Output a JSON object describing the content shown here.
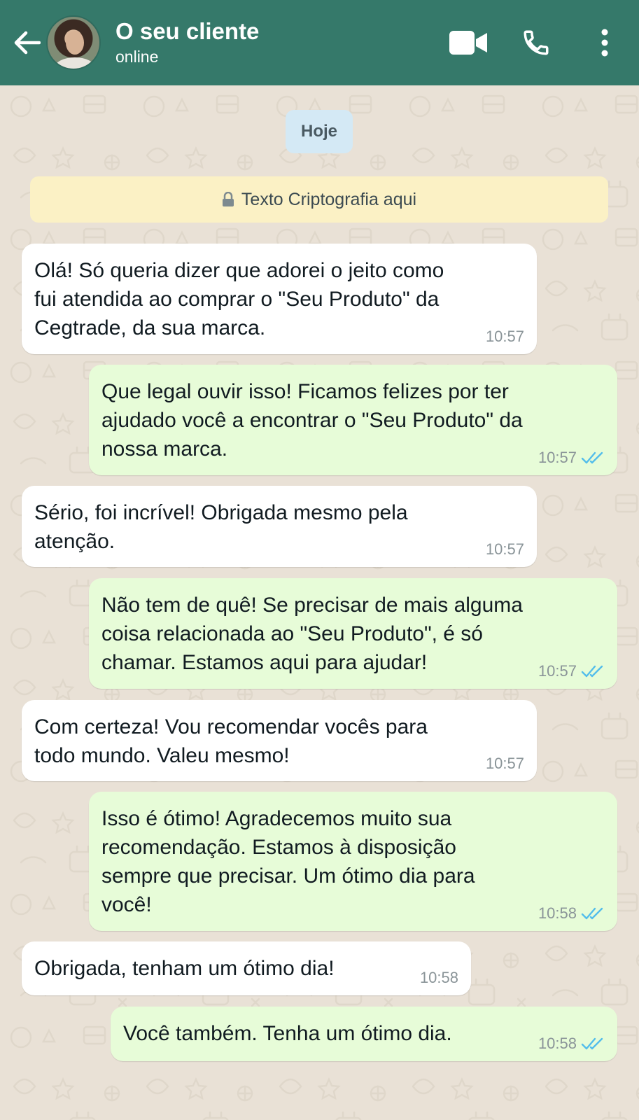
{
  "header": {
    "contact_name": "O seu cliente",
    "status": "online",
    "colors": {
      "bar": "#35796a",
      "icons": "#ffffff"
    },
    "icons": {
      "back": "arrow-left-icon",
      "video": "video-camera-icon",
      "call": "phone-icon",
      "menu": "dots-vertical-icon"
    }
  },
  "chat": {
    "date_chip": "Hoje",
    "encryption_banner": "Texto Criptografia aqui",
    "colors": {
      "incoming": "#ffffff",
      "outgoing": "#e7fcd8",
      "read_ticks": "#53bdeb"
    },
    "messages": [
      {
        "direction": "in",
        "lines": [
          "Olá! Só queria dizer que adorei o jeito como",
          "fui atendida ao comprar o \"Seu Produto\" da",
          "Cegtrade, da sua marca."
        ],
        "time": "10:57"
      },
      {
        "direction": "out",
        "lines": [
          "Que legal ouvir isso! Ficamos felizes por ter",
          "ajudado você a encontrar o \"Seu Produto\" da",
          "nossa marca."
        ],
        "time": "10:57",
        "status": "read"
      },
      {
        "direction": "in",
        "lines": [
          "Sério, foi incrível! Obrigada mesmo pela",
          "atenção."
        ],
        "time": "10:57"
      },
      {
        "direction": "out",
        "lines": [
          "Não tem de quê! Se precisar de mais alguma",
          "coisa relacionada ao \"Seu Produto\", é só",
          "chamar. Estamos aqui para ajudar!"
        ],
        "time": "10:57",
        "status": "read"
      },
      {
        "direction": "in",
        "lines": [
          "Com certeza! Vou recomendar vocês para",
          "todo mundo. Valeu mesmo!"
        ],
        "time": "10:57"
      },
      {
        "direction": "out",
        "lines": [
          "Isso é ótimo! Agradecemos muito sua",
          "recomendação. Estamos à disposição",
          "sempre que precisar. Um ótimo dia para",
          "você!"
        ],
        "time": "10:58",
        "status": "read"
      },
      {
        "direction": "in",
        "lines": [
          "Obrigada,  tenham um ótimo dia!"
        ],
        "time": "10:58"
      },
      {
        "direction": "out",
        "lines": [
          "Você também. Tenha um ótimo dia."
        ],
        "time": "10:58",
        "status": "read"
      }
    ]
  }
}
